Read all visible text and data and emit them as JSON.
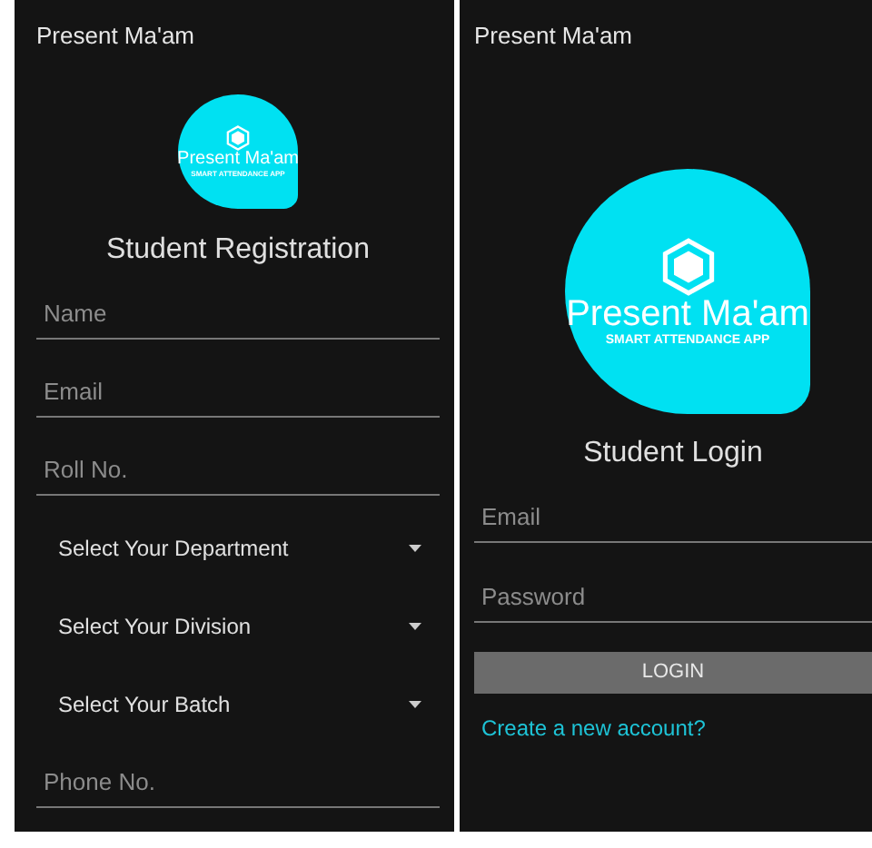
{
  "registration_screen": {
    "app_bar_title": "Present Ma'am",
    "logo": {
      "name": "Present Ma'am",
      "tagline": "SMART ATTENDANCE APP"
    },
    "heading": "Student Registration",
    "fields": [
      {
        "kind": "text",
        "placeholder": "Name"
      },
      {
        "kind": "text",
        "placeholder": "Email"
      },
      {
        "kind": "text",
        "placeholder": "Roll No."
      },
      {
        "kind": "dropdown",
        "label": "Select Your Department"
      },
      {
        "kind": "dropdown",
        "label": "Select Your Division"
      },
      {
        "kind": "dropdown",
        "label": "Select Your Batch"
      },
      {
        "kind": "text",
        "placeholder": "Phone No."
      }
    ]
  },
  "login_screen": {
    "app_bar_title": "Present Ma'am",
    "logo": {
      "name": "Present Ma'am",
      "tagline": "SMART ATTENDANCE APP"
    },
    "heading": "Student Login",
    "fields": [
      {
        "placeholder": "Email"
      },
      {
        "placeholder": "Password"
      }
    ],
    "button": "LOGIN",
    "link": "Create a new account?"
  }
}
